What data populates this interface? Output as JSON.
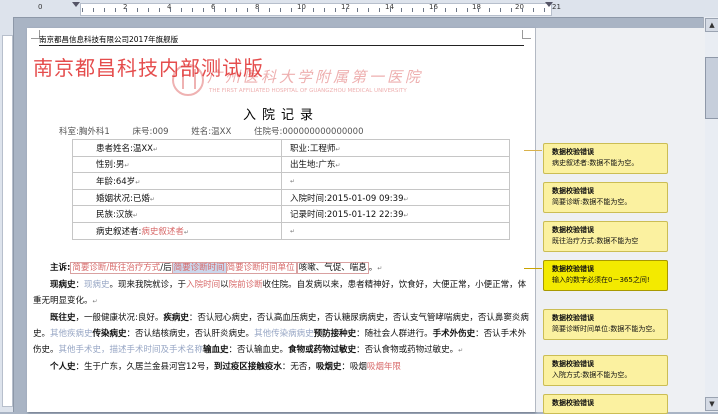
{
  "document": {
    "header_company": "南京都昌信息科技有限公司2017年旗舰版",
    "watermark_text": "南京都昌科技内部测试版",
    "hospital_name_cn": "广州医科大学附属第一医院",
    "hospital_name_en": "THE FIRST AFFILIATED HOSPITAL OF GUANGZHOU MEDICAL UNIVERSITY",
    "title": "入院记录",
    "info": {
      "department": "科室:胸外科1",
      "bed": "床号:009",
      "name": "姓名:温XX",
      "admission_no": "住院号:000000000000000"
    }
  },
  "patient_table": [
    {
      "left": "患者姓名:温XX",
      "right": "职业:工程师"
    },
    {
      "left": "性别:男",
      "right": "出生地:广东"
    },
    {
      "left": "年龄:64岁",
      "right": ""
    },
    {
      "left": "婚姻状况:已婚",
      "right": "入院时间:2015-01-09 09:39"
    },
    {
      "left": "民族:汉族",
      "right": "记录时间:2015-01-12 22:39"
    },
    {
      "left_label": "病史叙述者:",
      "left_field": "病史叙述者",
      "right": ""
    }
  ],
  "body": {
    "chief_label": "主诉:",
    "chief_f1": "简要诊断/既往治疗方式",
    "chief_sep": "/后",
    "chief_f2": "简要诊断时间",
    "chief_f3": "简要诊断时间单位",
    "chief_tail": "咳嗽、气促、喘息",
    "hpi_label": "现病史",
    "hpi_ph": "现病史",
    "hpi_a": "。现来我院就诊，于",
    "hpi_f": "入院时间",
    "hpi_b": "以",
    "hpi_f2": "院前诊断",
    "hpi_c": "收住院。自发病以来，患者精神好，饮食好，大便正常，小便正常，体重无明显变化。",
    "pmh_label": "既往史",
    "pmh_a": "，一般健康状况:良好。",
    "dz_label": "疾病史",
    "dz_a": "：否认冠心病史，否认高血压病史，否认糖尿病病史，否认支气管哮喘病史，否认鼻窦炎病史。",
    "dz_ph": "其他疾病史",
    "inf_label": "传染病史",
    "inf_a": "：否认结核病史，否认肝炎病史。",
    "inf_ph": "其他传染病病史",
    "vac_label": "预防接种史",
    "vac_a": "：随社会人群进行。",
    "op_label": "手术外伤史",
    "op_a": "：否认手术外伤史。",
    "op_ph": "其他手术史，描述手术时间及手术名称",
    "tr_label": "输血史",
    "tr_a": "：否认输血史。",
    "al_label": "食物或药物过敏史",
    "al_a": "：否认食物或药物过敏史。",
    "last_label": "个人史",
    "last_a": "：生于广东，久居兰金县河宫12号，",
    "last_b_label": "到过疫区接触疫水",
    "last_b": "：无否，",
    "last_c_label": "吸烟史",
    "last_c": "：吸烟",
    "last_d": "吸烟年限"
  },
  "comments": [
    {
      "title": "数据校验错误",
      "text": "病史叙述者:数据不能为空。",
      "active": false
    },
    {
      "title": "数据校验错误",
      "text": "简要诊断:数据不能为空。",
      "active": false
    },
    {
      "title": "数据校验错误",
      "text": "既往治疗方式:数据不能为空",
      "active": false
    },
    {
      "title": "数据校验错误",
      "text": "输入的数字必须在0－365之间!",
      "active": true
    },
    {
      "title": "数据校验错误",
      "text": "简要诊断时间单位:数据不能为空。",
      "active": false
    },
    {
      "title": "数据校验错误",
      "text": "入院方式:数据不能为空。",
      "active": false
    },
    {
      "title": "数据校验错误",
      "text": "",
      "active": false
    }
  ],
  "ruler": {
    "labels": [
      "2",
      "4",
      "6",
      "8",
      "10",
      "12",
      "14",
      "16",
      "18",
      "20"
    ],
    "start_label": "0",
    "end_label": "21"
  },
  "colors": {
    "comment_bg": "#fbf1a0",
    "comment_active_bg": "#f3ea00",
    "watermark": "#e33e3e",
    "field_text": "#d86a6a",
    "placeholder_text": "#98a7c5"
  }
}
